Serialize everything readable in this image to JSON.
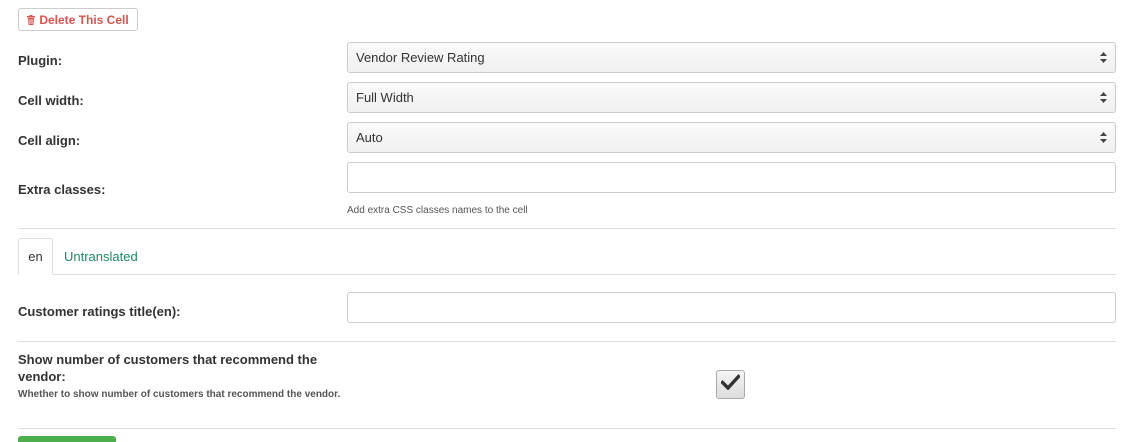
{
  "toolbar": {
    "delete_label": "Delete This Cell"
  },
  "form": {
    "plugin": {
      "label": "Plugin:",
      "value": "Vendor Review Rating"
    },
    "cell_width": {
      "label": "Cell width:",
      "value": "Full Width"
    },
    "cell_align": {
      "label": "Cell align:",
      "value": "Auto"
    },
    "extra_classes": {
      "label": "Extra classes:",
      "value": "",
      "help": "Add extra CSS classes names to the cell"
    }
  },
  "tabs": [
    {
      "label": "en",
      "active": true
    },
    {
      "label": "Untranslated",
      "active": false
    }
  ],
  "translated": {
    "ratings_title": {
      "label": "Customer ratings title(en):",
      "value": ""
    },
    "recommend": {
      "label": "Show number of customers that recommend the vendor:",
      "help": "Whether to show number of customers that recommend the vendor.",
      "checked": true
    }
  },
  "icons": {
    "delete": "trash-icon",
    "select": "updown-arrows-icon",
    "check": "checkmark-icon"
  },
  "colors": {
    "danger": "#d9534f",
    "tab_link": "#1a8a6a",
    "success": "#4cae4c"
  }
}
